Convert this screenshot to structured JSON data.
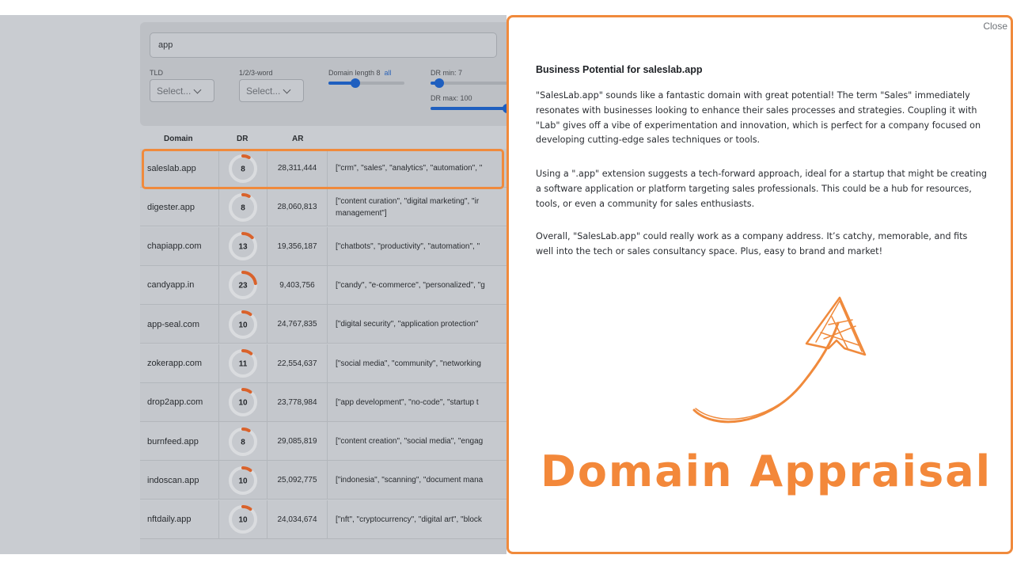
{
  "search": {
    "value": "app"
  },
  "filters": {
    "tld_label": "TLD",
    "tld_select": "Select...",
    "word_label": "1/2/3-word",
    "word_select": "Select...",
    "length_label": "Domain length 8",
    "length_all": "all",
    "length_value": 8,
    "dr_min_label": "DR min: 7",
    "dr_min_value": 7,
    "dr_max_label": "DR max: 100",
    "dr_max_value": 100
  },
  "table": {
    "headers": [
      "Domain",
      "DR",
      "AR"
    ],
    "rows": [
      {
        "domain": "saleslab.app",
        "dr": "8",
        "ar": "28,311,444",
        "tags": "[\"crm\", \"sales\", \"analytics\", \"automation\", \""
      },
      {
        "domain": "digester.app",
        "dr": "8",
        "ar": "28,060,813",
        "tags": "[\"content curation\", \"digital marketing\", \"ir management\"]"
      },
      {
        "domain": "chapiapp.com",
        "dr": "13",
        "ar": "19,356,187",
        "tags": "[\"chatbots\", \"productivity\", \"automation\", \""
      },
      {
        "domain": "candyapp.in",
        "dr": "23",
        "ar": "9,403,756",
        "tags": "[\"candy\", \"e-commerce\", \"personalized\", \"g"
      },
      {
        "domain": "app-seal.com",
        "dr": "10",
        "ar": "24,767,835",
        "tags": "[\"digital security\", \"application protection\""
      },
      {
        "domain": "zokerapp.com",
        "dr": "11",
        "ar": "22,554,637",
        "tags": "[\"social media\", \"community\", \"networking"
      },
      {
        "domain": "drop2app.com",
        "dr": "10",
        "ar": "23,778,984",
        "tags": "[\"app development\", \"no-code\", \"startup t"
      },
      {
        "domain": "burnfeed.app",
        "dr": "8",
        "ar": "29,085,819",
        "tags": "[\"content creation\", \"social media\", \"engag"
      },
      {
        "domain": "indoscan.app",
        "dr": "10",
        "ar": "25,092,775",
        "tags": "[\"indonesia\", \"scanning\", \"document mana"
      },
      {
        "domain": "nftdaily.app",
        "dr": "10",
        "ar": "24,034,674",
        "tags": "[\"nft\", \"cryptocurrency\", \"digital art\", \"block"
      }
    ]
  },
  "modal": {
    "close": "Close",
    "title": "Business Potential for saleslab.app",
    "p1": "\"SalesLab.app\" sounds like a fantastic domain with great potential! The term \"Sales\" immediately resonates with businesses looking to enhance their sales processes and strategies. Coupling it with \"Lab\" gives off a vibe of experimentation and innovation, which is perfect for a company focused on developing cutting-edge sales techniques or tools.",
    "p2": "Using a \".app\" extension suggests a tech-forward approach, ideal for a startup that might be creating a software application or platform targeting sales professionals. This could be a hub for resources, tools, or even a community for sales enthusiasts.",
    "p3": "Overall, \"SalesLab.app\" could really work as a company address. It’s catchy, memorable, and fits well into the tech or sales consultancy space. Plus, easy to brand and market!"
  },
  "promo": {
    "text": "Domain Appraisal"
  },
  "colors": {
    "accent": "#f08a3c",
    "gauge": "#d9622b",
    "slider": "#1f5fbf"
  }
}
